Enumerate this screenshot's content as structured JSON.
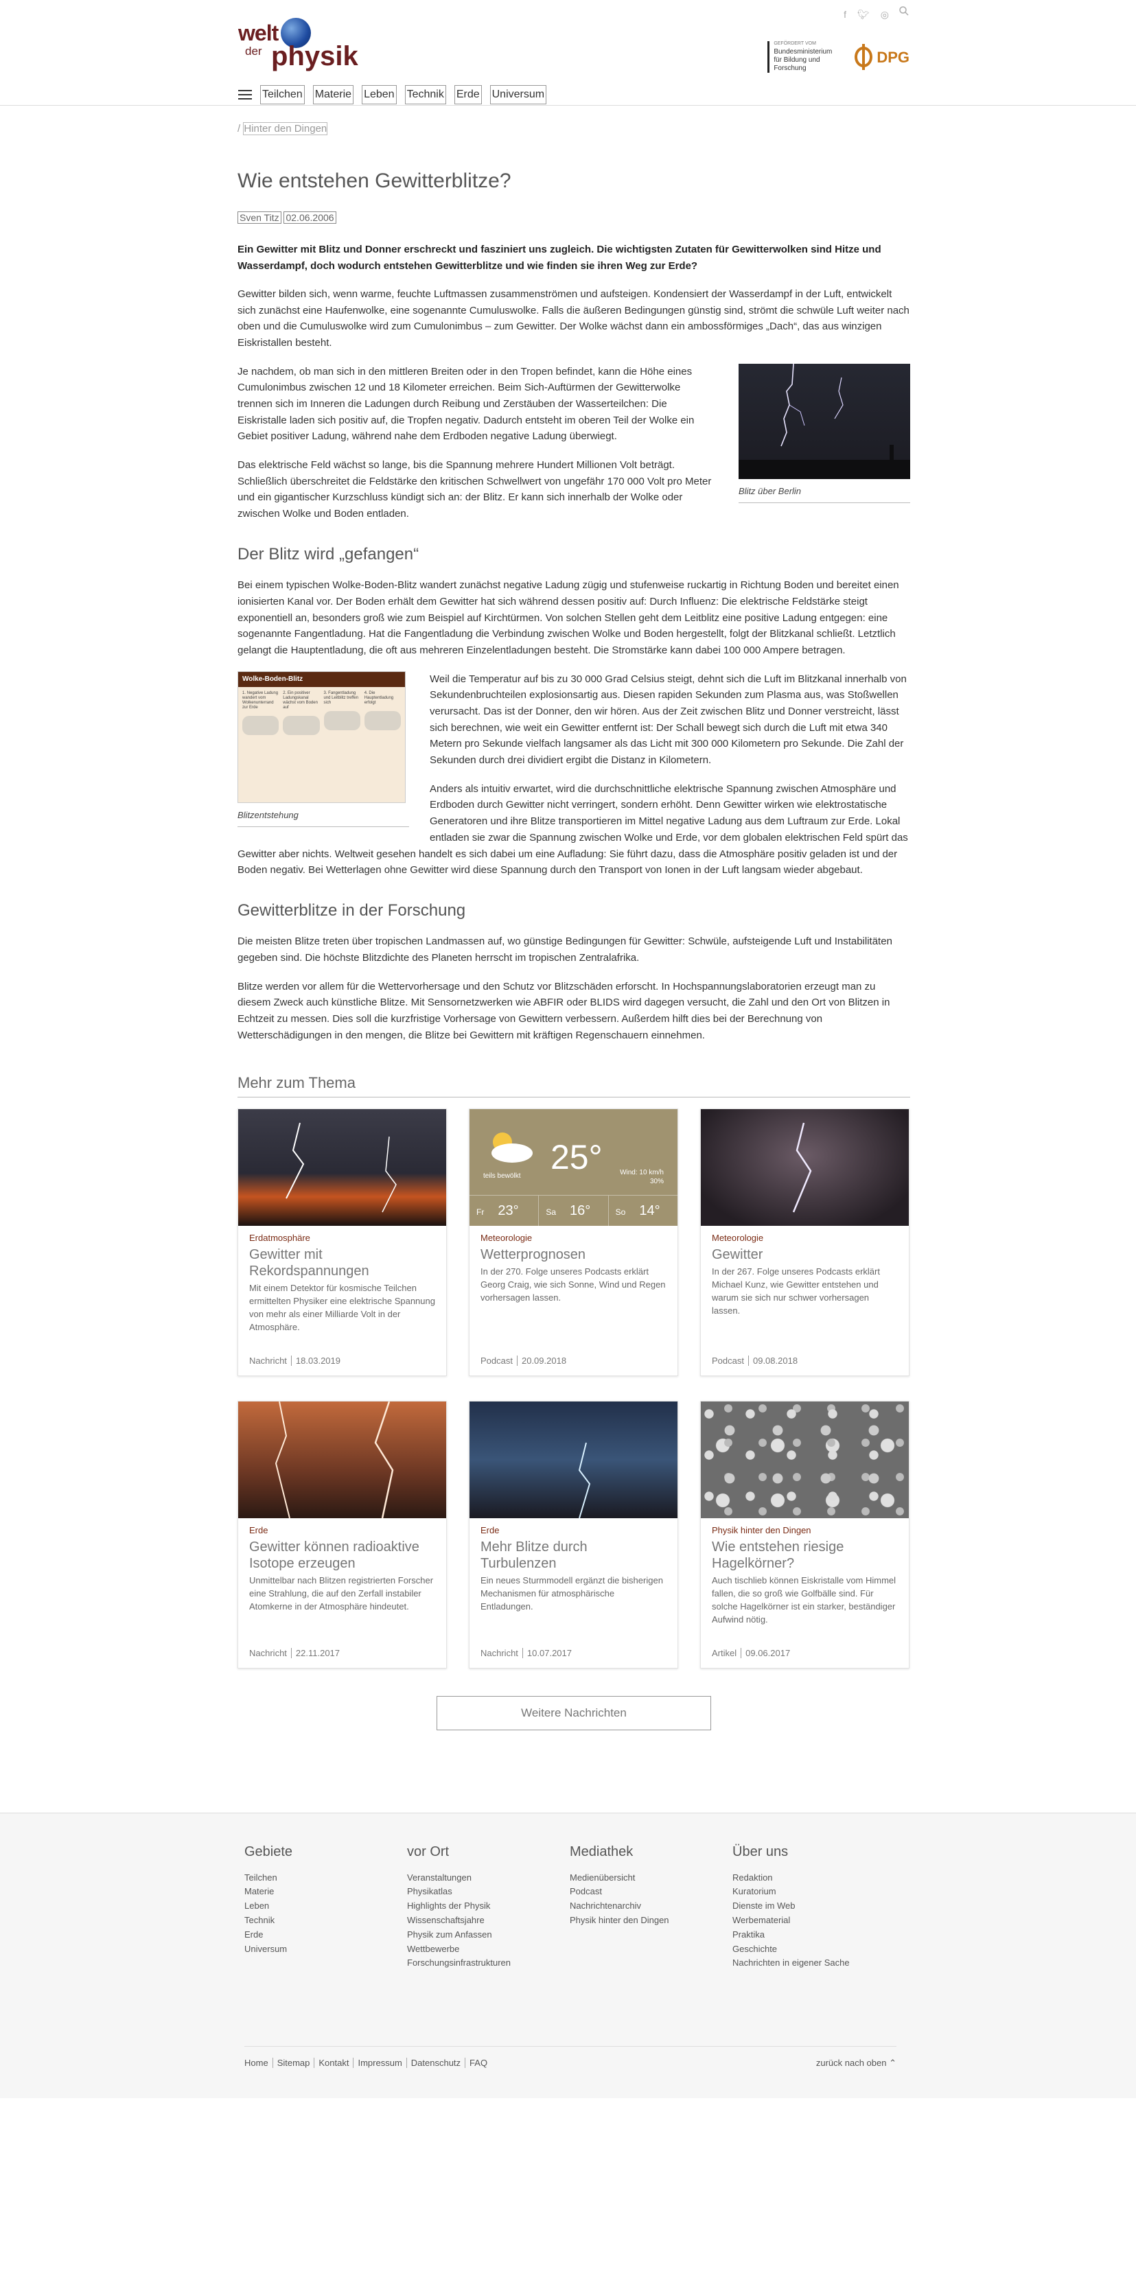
{
  "header": {
    "logo_line1": "welt",
    "logo_line2": "der",
    "logo_line3": "physik",
    "sponsor_small": "GEFÖRDERT VOM",
    "sponsor_bmbf": "Bundesministerium für Bildung und Forschung",
    "sponsor_dpg": "DPG",
    "social_icons": [
      "facebook-icon",
      "twitter-icon",
      "rss-icon",
      "search-icon"
    ],
    "nav": [
      "Teilchen",
      "Materie",
      "Leben",
      "Technik",
      "Erde",
      "Universum"
    ]
  },
  "article": {
    "breadcrumb": "Hinter den Dingen",
    "title": "Wie entstehen Gewitterblitze?",
    "author": "Sven Titz",
    "date": "02.06.2006",
    "lead": "Ein Gewitter mit Blitz und Donner erschreckt und fasziniert uns zugleich. Die wichtigsten Zutaten für Gewitterwolken sind Hitze und Wasserdampf, doch wodurch entstehen Gewitterblitze und wie finden sie ihren Weg zur Erde?",
    "p1": "Gewitter bilden sich, wenn warme, feuchte Luftmassen zusammenströmen und aufsteigen. Kondensiert der Wasserdampf in der Luft, entwickelt sich zunächst eine Haufenwolke, eine sogenannte Cumuluswolke. Falls die äußeren Bedingungen günstig sind, strömt die schwüle Luft weiter nach oben und die Cumuluswolke wird zum Cumulonimbus – zum Gewitter. Der Wolke wächst dann ein ambossförmiges „Dach“, das aus winzigen Eiskristallen besteht.",
    "p2": "Je nachdem, ob man sich in den mittleren Breiten oder in den Tropen befindet, kann die Höhe eines Cumulonimbus zwischen 12 und 18 Kilometer erreichen. Beim Sich-Auftürmen der Gewitterwolke trennen sich im Inneren die Ladungen durch Reibung und Zerstäuben der Wasserteilchen: Die Eiskristalle laden sich positiv auf, die Tropfen negativ. Dadurch entsteht im oberen Teil der Wolke ein Gebiet positiver Ladung, während nahe dem Erdboden negative Ladung überwiegt.",
    "photo_caption": "Blitz über Berlin",
    "p3": "Das elektrische Feld wächst so lange, bis die Spannung mehrere Hundert Millionen Volt beträgt. Schließlich überschreitet die Feldstärke den kritischen Schwellwert von ungefähr 170 000 Volt pro Meter und ein gigantischer Kurzschluss kündigt sich an: der Blitz. Er kann sich innerhalb der Wolke oder zwischen Wolke und Boden entladen.",
    "h2_1": "Der Blitz wird „gefangen“",
    "p4": "Bei einem typischen Wolke-Boden-Blitz wandert zunächst negative Ladung zügig und stufenweise ruckartig in Richtung Boden und bereitet einen ionisierten Kanal vor. Der Boden erhält dem Gewitter hat sich während dessen positiv auf: Durch Influenz: Die elektrische Feldstärke steigt exponentiell an, besonders groß wie zum Beispiel auf Kirchtürmen. Von solchen Stellen geht dem Leitblitz eine positive Ladung entgegen: eine sogenannte Fangentladung. Hat die Fangentladung die Verbindung zwischen Wolke und Boden hergestellt, folgt der Blitzkanal schließt. Letztlich gelangt die Hauptentladung, die oft aus mehreren Einzelentladungen besteht. Die Stromstärke kann dabei 100 000 Ampere betragen.",
    "diagram_title": "Wolke-Boden-Blitz",
    "diagram_cols": [
      "1. Negative Ladung wandert vom Wolkenunterrand zur Erde",
      "2. Ein positiver Ladungskanal wächst vom Boden auf",
      "3. Fangentladung und Leitblitz treffen sich",
      "4. Die Hauptentladung erfolgt"
    ],
    "diagram_caption": "Blitzentstehung",
    "p5": "Weil die Temperatur auf bis zu 30 000 Grad Celsius steigt, dehnt sich die Luft im Blitzkanal innerhalb von Sekundenbruchteilen explosionsartig aus. Diesen rapiden Sekunden zum Plasma aus, was Stoßwellen verursacht. Das ist der Donner, den wir hören. Aus der Zeit zwischen Blitz und Donner verstreicht, lässt sich berechnen, wie weit ein Gewitter entfernt ist: Der Schall bewegt sich durch die Luft mit etwa 340 Metern pro Sekunde vielfach langsamer als das Licht mit 300 000 Kilometern pro Sekunde. Die Zahl der Sekunden durch drei dividiert ergibt die Distanz in Kilometern.",
    "p6": "Anders als intuitiv erwartet, wird die durchschnittliche elektrische Spannung zwischen Atmosphäre und Erdboden durch Gewitter nicht verringert, sondern erhöht. Denn Gewitter wirken wie elektrostatische Generatoren und ihre Blitze transportieren im Mittel negative Ladung aus dem Luftraum zur Erde. Lokal entladen sie zwar die Spannung zwischen Wolke und Erde, vor dem globalen elektrischen Feld spürt das Gewitter aber nichts. Weltweit gesehen handelt es sich dabei um eine Aufladung: Sie führt dazu, dass die Atmosphäre positiv geladen ist und der Boden negativ. Bei Wetterlagen ohne Gewitter wird diese Spannung durch den Transport von Ionen in der Luft langsam wieder abgebaut.",
    "h2_2": "Gewitterblitze in der Forschung",
    "p7": "Die meisten Blitze treten über tropischen Landmassen auf, wo günstige Bedingungen für Gewitter: Schwüle, aufsteigende Luft und Instabilitäten gegeben sind. Die höchste Blitzdichte des Planeten herrscht im tropischen Zentralafrika.",
    "p8": "Blitze werden vor allem für die Wettervorhersage und den Schutz vor Blitzschäden erforscht. In Hochspannungslaboratorien erzeugt man zu diesem Zweck auch künstliche Blitze. Mit Sensornetzwerken wie ABFIR oder BLIDS wird dagegen versucht, die Zahl und den Ort von Blitzen in Echtzeit zu messen. Dies soll die kurzfristige Vorhersage von Gewittern verbessern. Außerdem hilft dies bei der Berechnung von Wetterschädigungen in den mengen, die Blitze bei Gewittern mit kräftigen Regenschauern einnehmen."
  },
  "more": {
    "heading": "Mehr zum Thema",
    "cards": [
      {
        "category": "Erdatmosphäre",
        "title": "Gewitter mit Rekordspannungen",
        "teaser": "Mit einem Detektor für kosmische Teilchen ermittelten Physiker eine elektrische Spannung von mehr als einer Milliarde Volt in der Atmosphäre.",
        "type": "Nachricht",
        "date": "18.03.2019"
      },
      {
        "category": "Meteorologie",
        "title": "Wetterprognosen",
        "teaser": "In der 270. Folge unseres Podcasts erklärt Georg Craig, wie sich Sonne, Wind und Regen vorhersagen lassen.",
        "type": "Podcast",
        "date": "20.09.2018"
      },
      {
        "category": "Meteorologie",
        "title": "Gewitter",
        "teaser": "In der 267. Folge unseres Podcasts erklärt Michael Kunz, wie Gewitter entstehen und warum sie sich nur schwer vorhersagen lassen.",
        "type": "Podcast",
        "date": "09.08.2018"
      },
      {
        "category": "Erde",
        "title": "Gewitter können radioaktive Isotope erzeugen",
        "teaser": "Unmittelbar nach Blitzen registrierten Forscher eine Strahlung, die auf den Zerfall instabiler Atomkerne in der Atmosphäre hindeutet.",
        "type": "Nachricht",
        "date": "22.11.2017"
      },
      {
        "category": "Erde",
        "title": "Mehr Blitze durch Turbulenzen",
        "teaser": "Ein neues Sturmmodell ergänzt die bisherigen Mechanismen für atmosphärische Entladungen.",
        "type": "Nachricht",
        "date": "10.07.2017"
      },
      {
        "category": "Physik hinter den Dingen",
        "title": "Wie entstehen riesige Hagelkörner?",
        "teaser": "Auch tischlieb können Eiskristalle vom Himmel fallen, die so groß wie Golfbälle sind. Für solche Hagelkörner ist ein starker, beständiger Aufwind nötig.",
        "type": "Artikel",
        "date": "09.06.2017"
      }
    ],
    "weather": {
      "temp": "25°",
      "label": "teils bewölkt",
      "wind": "Wind: 10 km/h",
      "rain": "30%",
      "days": [
        {
          "d": "Fr",
          "t": "23°"
        },
        {
          "d": "Sa",
          "t": "16°"
        },
        {
          "d": "So",
          "t": "14°"
        }
      ]
    },
    "button": "Weitere Nachrichten"
  },
  "footer": {
    "cols": [
      {
        "h": "Gebiete",
        "items": [
          "Teilchen",
          "Materie",
          "Leben",
          "Technik",
          "Erde",
          "Universum"
        ]
      },
      {
        "h": "vor Ort",
        "items": [
          "Veranstaltungen",
          "Physikatlas",
          "Highlights der Physik",
          "Wissenschaftsjahre",
          "Physik zum Anfassen",
          "Wettbewerbe",
          "Forschungsinfrastrukturen"
        ]
      },
      {
        "h": "Mediathek",
        "items": [
          "Medienübersicht",
          "Podcast",
          "Nachrichtenarchiv",
          "Physik hinter den Dingen"
        ]
      },
      {
        "h": "Über uns",
        "items": [
          "Redaktion",
          "Kuratorium",
          "Dienste im Web",
          "Werbematerial",
          "Praktika",
          "Geschichte",
          "Nachrichten in eigener Sache"
        ]
      }
    ],
    "links": [
      "Home",
      "Sitemap",
      "Kontakt",
      "Impressum",
      "Datenschutz",
      "FAQ"
    ],
    "back_top": "zurück nach oben"
  }
}
